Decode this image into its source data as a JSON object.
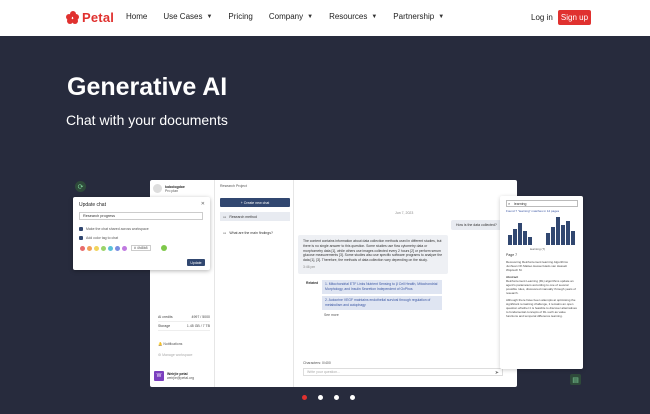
{
  "brand": {
    "name": "Petal",
    "color": "#e0312f"
  },
  "nav": {
    "links": [
      {
        "label": "Home",
        "has_menu": false
      },
      {
        "label": "Use Cases",
        "has_menu": true
      },
      {
        "label": "Pricing",
        "has_menu": false
      },
      {
        "label": "Company",
        "has_menu": true
      },
      {
        "label": "Resources",
        "has_menu": true
      },
      {
        "label": "Partnership",
        "has_menu": true
      }
    ],
    "login": "Log in",
    "signup": "Sign up"
  },
  "hero": {
    "title": "Generative AI",
    "subtitle": "Chat with your documents"
  },
  "app": {
    "sidebar": {
      "user_name": "kobologdoe",
      "user_plan": "Pro plan",
      "ai_credits_label": "AI credits",
      "ai_credits_value": "4997 / 5000",
      "storage_label": "Storage",
      "storage_value": "1.45 GB / 7 TB",
      "notifications": "Notifications",
      "manage_workspace": "Manage workspace",
      "footer_initial": "W",
      "footer_name": "Weirjie petal",
      "footer_email": "weirjie@petal.org"
    },
    "chatlist": {
      "title": "Research Project",
      "create_label": "+ Create new chat",
      "items": [
        {
          "label": "Research method",
          "active": true
        },
        {
          "label": "What are the main findings?",
          "active": false
        }
      ]
    },
    "convo": {
      "date": "Jun 7, 2023",
      "question": "How is the data collected?",
      "answer": "The content contains information about data collection methods used in different studies, but there is no single answer to this question. Some studies use flow cytometry data or morphometry data [1], while others use images collected every 2 hours [2] or perform serum glucose measurements [3]. Some studies also use specific software programs to analyze the data [1], [3]. Therefore, the methods of data collection vary depending on the study.",
      "time": "3:46 pm",
      "related_label": "Related",
      "related": [
        "1. Mitochondrial ETF Links Nutrient Sensing to β Cell Health, Mitochondrial Morphology, and Insulin Secretion Independent of OxPhos",
        "2. Autocrine VEGF maintains endothelial survival through regulation of metabolism and autophagy"
      ],
      "see_more": "See more",
      "char_count": "Characters: 0/400",
      "input_placeholder": "Write your question..."
    }
  },
  "modal": {
    "title": "Update chat",
    "field_value": "Research progress",
    "check1": "Make the chat shared across workspace",
    "check2": "Add color tag to chat",
    "swatch_colors": [
      "#e86b6b",
      "#f0a15a",
      "#f2d45c",
      "#9bd46a",
      "#5ac0d8",
      "#7a8de0",
      "#c07ae0"
    ],
    "custom_label": "# 4fd8b8",
    "update_label": "Update"
  },
  "pdf": {
    "search_value": "learning",
    "found": "Found 7 \"learning\" matches in 12 pages",
    "histogram_legend": "learning (7)",
    "page_label": "Page 7",
    "text_lines": [
      "Recovering Reinforcement learning Algorithms",
      "Junhuan Oh Matteo Hessel Hado van Hasselt",
      "Wojciech M.",
      "Abstract",
      "Reinforcement Learning (RL) algorithms update an agent's parameters according to one of several possible rules, discovered manually through years of research.",
      "Although there have been attempts at optimising the significant remaining challenge, it remains an open question whether it is feasible to discover alternatives to fundamental concepts of RL such as value functions and temporal difference learning."
    ]
  },
  "carousel": {
    "count": 4,
    "active_index": 0
  }
}
